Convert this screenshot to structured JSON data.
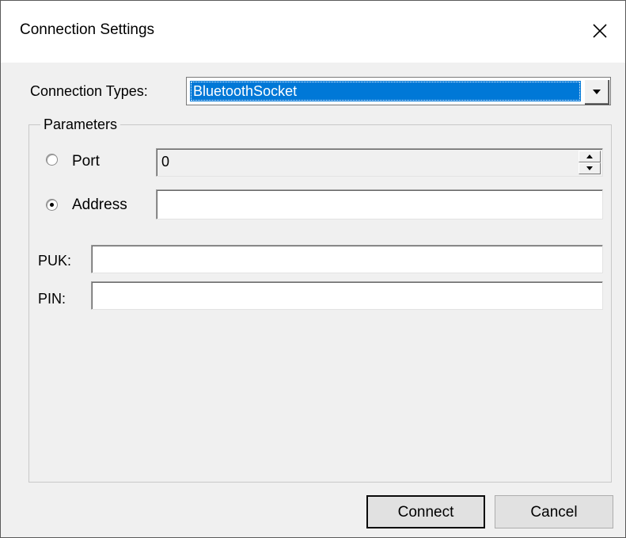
{
  "window": {
    "title": "Connection Settings",
    "close_icon": "close-icon"
  },
  "connection": {
    "label": "Connection Types:",
    "selected": "BluetoothSocket",
    "dropdown_icon": "chevron-down-icon"
  },
  "parameters": {
    "legend": "Parameters",
    "port": {
      "label": "Port",
      "selected": false,
      "value": "0",
      "enabled": false
    },
    "address": {
      "label": "Address",
      "selected": true,
      "value": ""
    }
  },
  "fields": {
    "puk": {
      "label": "PUK:",
      "value": ""
    },
    "pin": {
      "label": "PIN:",
      "value": ""
    }
  },
  "buttons": {
    "connect": "Connect",
    "cancel": "Cancel"
  },
  "colors": {
    "selection": "#0078d7",
    "dialog_bg": "#f0f0f0",
    "title_bg": "#ffffff"
  }
}
